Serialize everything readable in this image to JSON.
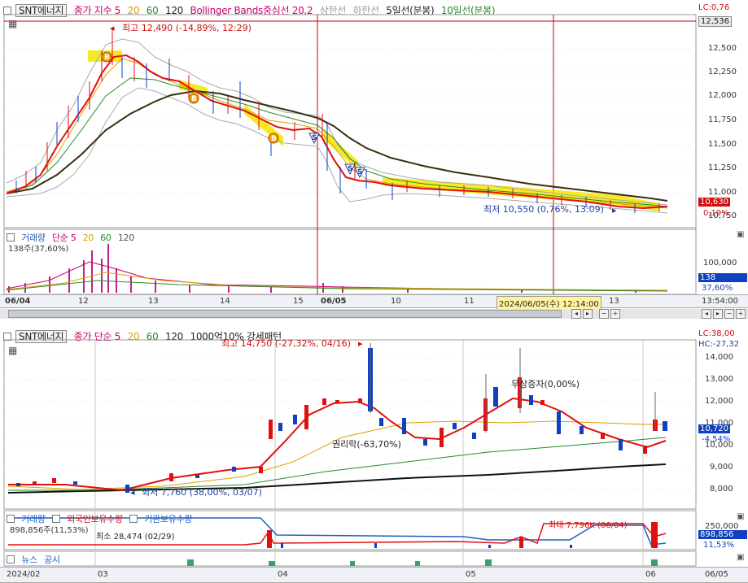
{
  "top": {
    "stock_name": "SNT에너지",
    "header_items": [
      {
        "text": "종가 지수 5",
        "color": "#c8006e"
      },
      {
        "text": "20",
        "color": "#e0a000"
      },
      {
        "text": "60",
        "color": "#2a8a2a"
      },
      {
        "text": "120",
        "color": "#222222"
      },
      {
        "text": "Bollinger Bands중심선 20,2",
        "color": "#c8006e"
      },
      {
        "text": "상한선",
        "color": "#9a9a9a"
      },
      {
        "text": "하한선",
        "color": "#9a9a9a"
      },
      {
        "text": "5일선(분봉)",
        "color": "#222222"
      },
      {
        "text": "10일선(분봉)",
        "color": "#2a8a2a"
      }
    ],
    "lc": "LC:0,76",
    "price_ticks": [
      "12,500",
      "12,250",
      "12,000",
      "11,750",
      "11,500",
      "11,250",
      "11,000",
      "10,750"
    ],
    "cursor_price": "12,536",
    "current_price": "10,630",
    "current_change": "0,19%",
    "max_label": "최고 12,490 (-14,89%, 12:29)",
    "min_label": "최저 10,550 (0,76%, 13:09)",
    "signals": [
      "B",
      "B",
      "B",
      "S",
      "S",
      "S"
    ],
    "volume": {
      "title_items": [
        {
          "text": "거래량",
          "color": "#2060c0"
        },
        {
          "text": "단순 5",
          "color": "#c8006e"
        },
        {
          "text": "20",
          "color": "#e0a000"
        },
        {
          "text": "60",
          "color": "#2a8a2a"
        },
        {
          "text": "120",
          "color": "#555555"
        }
      ],
      "value_label": "138주(37,60%)",
      "tick": "100,000",
      "current": "138",
      "current_pct": "37,60%"
    },
    "date_axis": [
      "06/04",
      "12",
      "13",
      "14",
      "15",
      "06/05",
      "10",
      "11",
      "13"
    ],
    "cursor_datetime": "2024/06/05(수) 12:14:00",
    "time_display": "13:54:00"
  },
  "bottom": {
    "stock_name": "SNT에너지",
    "header_items": [
      {
        "text": "종가 단순 5",
        "color": "#c8006e"
      },
      {
        "text": "20",
        "color": "#e0a000"
      },
      {
        "text": "60",
        "color": "#2a8a2a"
      },
      {
        "text": "120",
        "color": "#222222"
      },
      {
        "text": "1000억10% 강세패턴",
        "color": "#222222"
      }
    ],
    "lc": "LC:38,00",
    "hc": "HC:-27,32",
    "price_ticks": [
      "14,000",
      "13,000",
      "12,000",
      "11,000",
      "10,000",
      "9,000",
      "8,000"
    ],
    "current_price": "10,720",
    "current_change": "-4,54%",
    "max_label": "최고 14,750 (-27,32%, 04/16)",
    "min_label": "최저 7,760 (38,00%, 03/07)",
    "annotation_1": "무상증자(0,00%)",
    "annotation_2": "권리락(-63,70%)",
    "holding": {
      "title_items": [
        {
          "text": "거래량",
          "color": "#2060c0"
        },
        {
          "text": "외국인보유수량",
          "color": "#d01010"
        },
        {
          "text": "기관보유수량",
          "color": "#2060c0"
        }
      ],
      "value_label": "898,856주(11,53%)",
      "min_label": "최소 28,474 (02/29)",
      "max_label": "최대 7,796K (06/04)",
      "tick": "250,000",
      "current": "898,856",
      "current_pct": "11,53%"
    },
    "news": {
      "items": [
        {
          "text": "뉴스",
          "color": "#2060c0"
        },
        {
          "text": "공시",
          "color": "#2060c0"
        }
      ]
    },
    "date_axis": [
      "2024/02",
      "03",
      "04",
      "05",
      "06",
      "06/05"
    ]
  }
}
